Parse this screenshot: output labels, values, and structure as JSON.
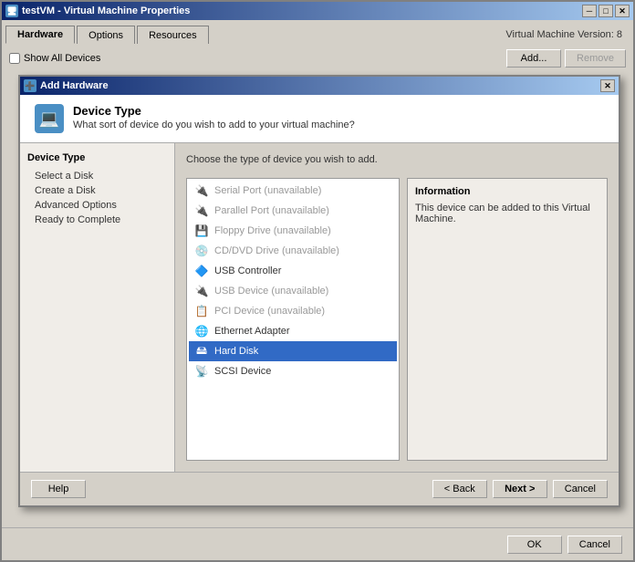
{
  "window": {
    "title": "testVM - Virtual Machine Properties",
    "vm_version": "Virtual Machine Version: 8",
    "title_icon": "🖥",
    "close_btn": "✕",
    "min_btn": "─",
    "max_btn": "□"
  },
  "tabs": [
    {
      "label": "Hardware",
      "active": true
    },
    {
      "label": "Options",
      "active": false
    },
    {
      "label": "Resources",
      "active": false
    }
  ],
  "toolbar": {
    "show_all_devices": "Show All Devices",
    "add_button": "Add...",
    "remove_button": "Remove"
  },
  "modal": {
    "title": "Add Hardware",
    "title_icon": "➕",
    "header": {
      "title": "Device Type",
      "subtitle": "What sort of device do you wish to add to your virtual machine?"
    },
    "sidebar": {
      "section_title": "Device Type",
      "items": [
        {
          "label": "Select a Disk",
          "active": false
        },
        {
          "label": "Create a Disk",
          "active": false
        },
        {
          "label": "Advanced Options",
          "active": false
        },
        {
          "label": "Ready to Complete",
          "active": false
        }
      ]
    },
    "main": {
      "instruction": "Choose the type of device you wish to add.",
      "devices": [
        {
          "label": "Serial Port (unavailable)",
          "icon": "🔌",
          "available": false,
          "selected": false
        },
        {
          "label": "Parallel Port (unavailable)",
          "icon": "🔌",
          "available": false,
          "selected": false
        },
        {
          "label": "Floppy Drive (unavailable)",
          "icon": "💾",
          "available": false,
          "selected": false
        },
        {
          "label": "CD/DVD Drive (unavailable)",
          "icon": "💿",
          "available": false,
          "selected": false
        },
        {
          "label": "USB Controller",
          "icon": "🔷",
          "available": true,
          "selected": false
        },
        {
          "label": "USB Device (unavailable)",
          "icon": "🔌",
          "available": false,
          "selected": false
        },
        {
          "label": "PCI Device (unavailable)",
          "icon": "📋",
          "available": false,
          "selected": false
        },
        {
          "label": "Ethernet Adapter",
          "icon": "🌐",
          "available": true,
          "selected": false
        },
        {
          "label": "Hard Disk",
          "icon": "🖴",
          "available": true,
          "selected": true
        },
        {
          "label": "SCSI Device",
          "icon": "📡",
          "available": true,
          "selected": false
        }
      ]
    },
    "info_panel": {
      "title": "Information",
      "text": "This device can be added to this Virtual Machine."
    },
    "footer": {
      "back_button": "< Back",
      "next_button": "Next >",
      "cancel_button": "Cancel"
    }
  },
  "outer_footer": {
    "help_button": "Help",
    "ok_button": "OK",
    "cancel_button": "Cancel"
  }
}
